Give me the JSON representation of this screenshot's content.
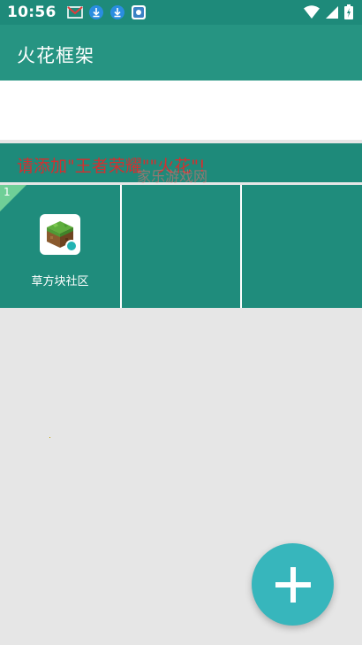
{
  "status_bar": {
    "time": "10:56",
    "notification_icons": [
      "gmail-icon",
      "download-icon",
      "download-icon",
      "photo-icon"
    ],
    "system_icons": [
      "wifi-icon",
      "signal-icon",
      "battery-charging-icon"
    ]
  },
  "app_bar": {
    "title": "火花框架"
  },
  "notice": {
    "text": "请添加\"王者荣耀\"\"火花\"!",
    "watermark": "家乐游戏网"
  },
  "tiles": [
    {
      "badge": "1",
      "label": "草方块社区",
      "icon": "grass-block-icon"
    },
    {
      "badge": "",
      "label": "",
      "icon": ""
    },
    {
      "badge": "",
      "label": "",
      "icon": ""
    }
  ],
  "fab": {
    "icon": "plus-icon"
  },
  "colors": {
    "status_bar": "#1e8a7a",
    "app_bar": "#269482",
    "tile": "#1f8c7c",
    "notice_text": "#d23030",
    "fab": "#37b6bc",
    "badge": "#6fcf97",
    "background": "#e6e6e6"
  }
}
